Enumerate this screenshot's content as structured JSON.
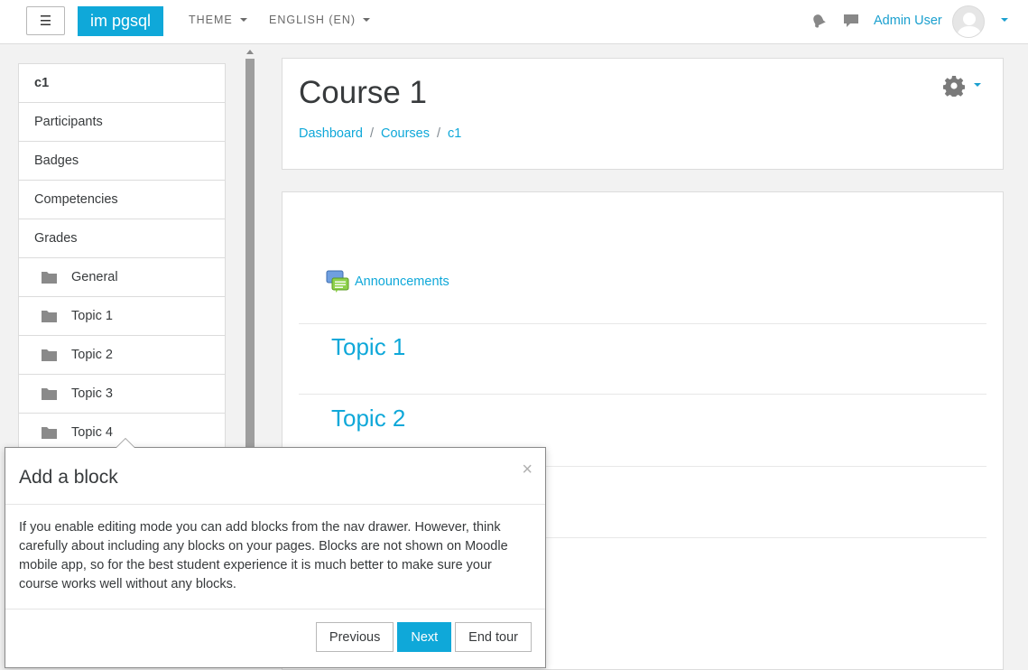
{
  "navbar": {
    "brand": "im pgsql",
    "menus": [
      "THEME",
      "ENGLISH (EN)"
    ],
    "user_name": "Admin User",
    "icons": [
      "hamburger-icon",
      "bell-icon",
      "chat-icon",
      "avatar"
    ]
  },
  "drawer": {
    "items": [
      {
        "label": "c1",
        "bold": true
      },
      {
        "label": "Participants"
      },
      {
        "label": "Badges"
      },
      {
        "label": "Competencies"
      },
      {
        "label": "Grades"
      },
      {
        "label": "General",
        "folder": true
      },
      {
        "label": "Topic 1",
        "folder": true
      },
      {
        "label": "Topic 2",
        "folder": true
      },
      {
        "label": "Topic 3",
        "folder": true
      },
      {
        "label": "Topic 4",
        "folder": true
      }
    ]
  },
  "header": {
    "title": "Course 1",
    "breadcrumb": [
      "Dashboard",
      "Courses",
      "c1"
    ]
  },
  "content": {
    "announcements": "Announcements",
    "sections": [
      "Topic 1",
      "Topic 2"
    ]
  },
  "tour": {
    "title": "Add a block",
    "close": "×",
    "body": "If you enable editing mode you can add blocks from the nav drawer. However, think carefully about including any blocks on your pages. Blocks are not shown on Moodle mobile app, so for the best student experience it is much better to make sure your course works well without any blocks.",
    "buttons": {
      "previous": "Previous",
      "next": "Next",
      "end": "End tour"
    }
  },
  "colors": {
    "accent": "#0fa8d9",
    "text": "#373a3c",
    "background": "#f2f2f2"
  }
}
